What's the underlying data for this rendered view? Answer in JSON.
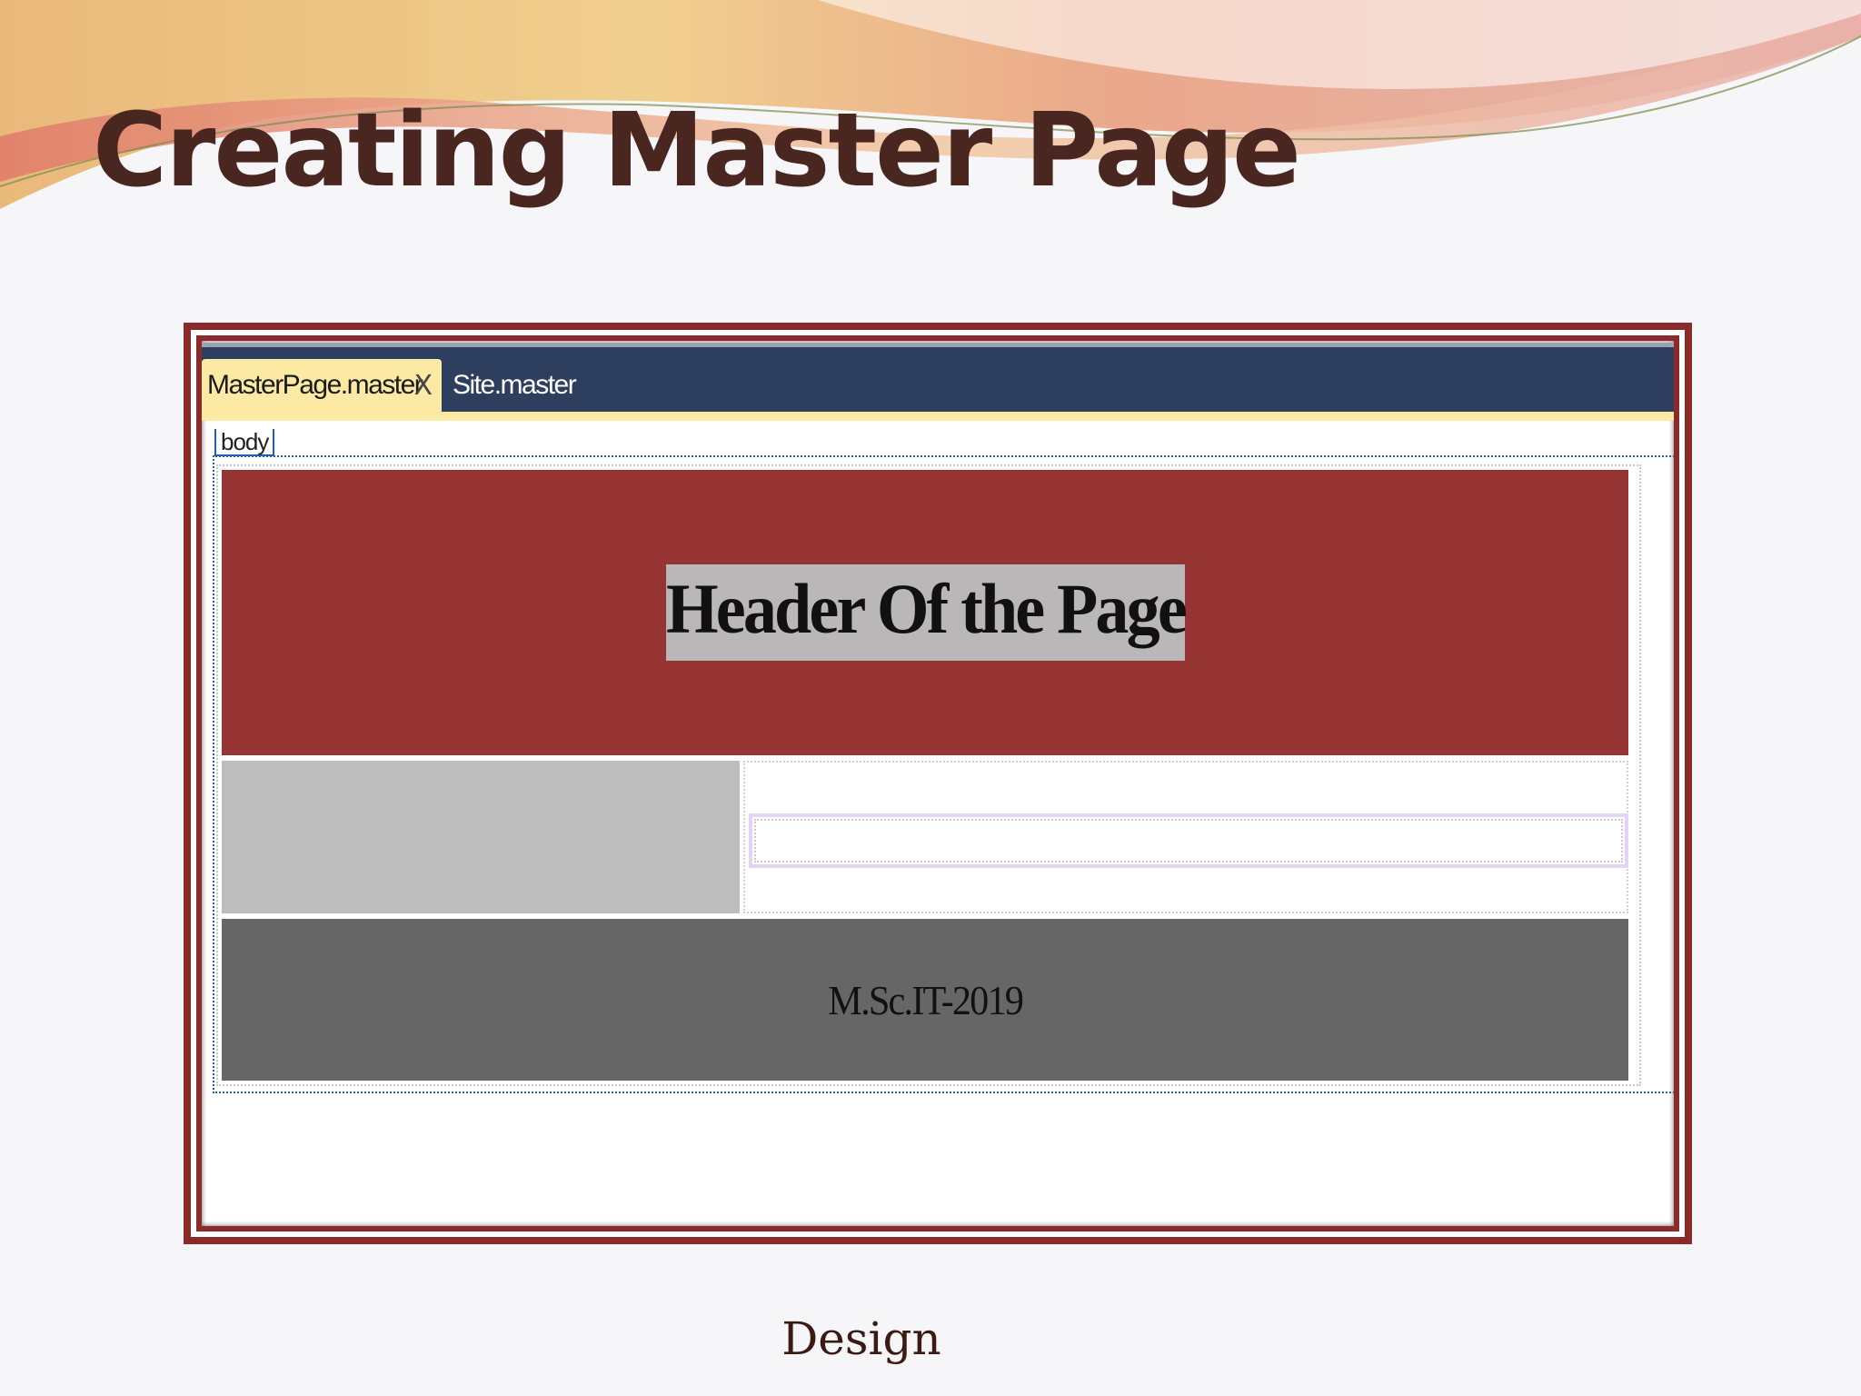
{
  "slide": {
    "title": "Creating Master Page",
    "caption": "Design"
  },
  "editor": {
    "tabs": [
      {
        "label": "MasterPage.master",
        "active": true,
        "close_glyph": "X"
      },
      {
        "label": "Site.master",
        "active": false
      }
    ],
    "body_tag": "body"
  },
  "design": {
    "header_text": "Header Of the Page",
    "footer_text": "M.Sc.IT-2019"
  },
  "colors": {
    "header_bg": "#963333",
    "sidebar_bg": "#bdbdbd",
    "footer_bg": "#666666",
    "tabbar_bg": "#2d3e5f",
    "active_tab_bg": "#fce9a3",
    "frame_border": "#8b2a2a",
    "title_color": "#4a2620"
  },
  "icons": [
    "close-icon"
  ]
}
